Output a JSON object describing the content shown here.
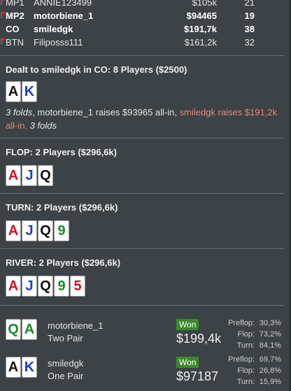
{
  "players": [
    {
      "pos": "MP1",
      "name": "ANNIE123499",
      "stack": "$105k",
      "bb": "21",
      "flag": true,
      "bold": false
    },
    {
      "pos": "MP2",
      "name": "motorbiene_1",
      "stack": "$94465",
      "bb": "19",
      "flag": true,
      "bold": true
    },
    {
      "pos": "CO",
      "name": "smiledgk",
      "stack": "$191,7k",
      "bb": "38",
      "flag": false,
      "bold": true
    },
    {
      "pos": "BTN",
      "name": "Filiposss111",
      "stack": "$161,2k",
      "bb": "32",
      "flag": true,
      "bold": false
    }
  ],
  "preflop": {
    "heading": "Dealt to smiledgk in CO: 8 Players ($2500)",
    "cards": [
      {
        "r": "A",
        "c": "black"
      },
      {
        "r": "K",
        "c": "blue"
      }
    ],
    "action": {
      "p1": "3 folds",
      "p2": ", motorbiene_1 raises $93965 all-in, ",
      "p3": "smiledgk raises $191,2k all-in,",
      "p4": " ",
      "p5": "3 folds"
    }
  },
  "flop": {
    "heading": "FLOP: 2 Players ($296,6k)",
    "cards": [
      {
        "r": "A",
        "c": "red"
      },
      {
        "r": "J",
        "c": "blue"
      },
      {
        "r": "Q",
        "c": "black"
      }
    ]
  },
  "turn": {
    "heading": "TURN: 2 Players ($296,6k)",
    "cards": [
      {
        "r": "A",
        "c": "red"
      },
      {
        "r": "J",
        "c": "blue"
      },
      {
        "r": "Q",
        "c": "black"
      },
      {
        "r": "9",
        "c": "green"
      }
    ]
  },
  "river": {
    "heading": "RIVER: 2 Players ($296,6k)",
    "cards": [
      {
        "r": "A",
        "c": "red"
      },
      {
        "r": "J",
        "c": "blue"
      },
      {
        "r": "Q",
        "c": "black"
      },
      {
        "r": "9",
        "c": "green"
      },
      {
        "r": "5",
        "c": "red"
      }
    ]
  },
  "results": [
    {
      "cards": [
        {
          "r": "Q",
          "c": "green"
        },
        {
          "r": "A",
          "c": "green"
        }
      ],
      "name": "motorbiene_1",
      "hand": "Two Pair",
      "won": "Won",
      "amount": "$199,4k",
      "equity": [
        {
          "label": "Preflop:",
          "value": "30,3%"
        },
        {
          "label": "Flop:",
          "value": "73,2%"
        },
        {
          "label": "Turn:",
          "value": "84,1%"
        }
      ]
    },
    {
      "cards": [
        {
          "r": "A",
          "c": "black"
        },
        {
          "r": "K",
          "c": "blue"
        }
      ],
      "name": "smiledgk",
      "hand": "One Pair",
      "won": "Won",
      "amount": "$97187",
      "equity": [
        {
          "label": "Preflop:",
          "value": "69,7%"
        },
        {
          "label": "Flop:",
          "value": "26,8%"
        },
        {
          "label": "Turn:",
          "value": "15,9%"
        }
      ]
    }
  ],
  "colors": {
    "red": "#c8102e",
    "blue": "#1f3fbf",
    "black": "#101010",
    "green": "#1a8a2a",
    "highlight": "#e8857a",
    "won_bg": "#3a8a2a",
    "flag": "#d22a2a"
  },
  "icons": {
    "flag": "red-flag-icon"
  }
}
